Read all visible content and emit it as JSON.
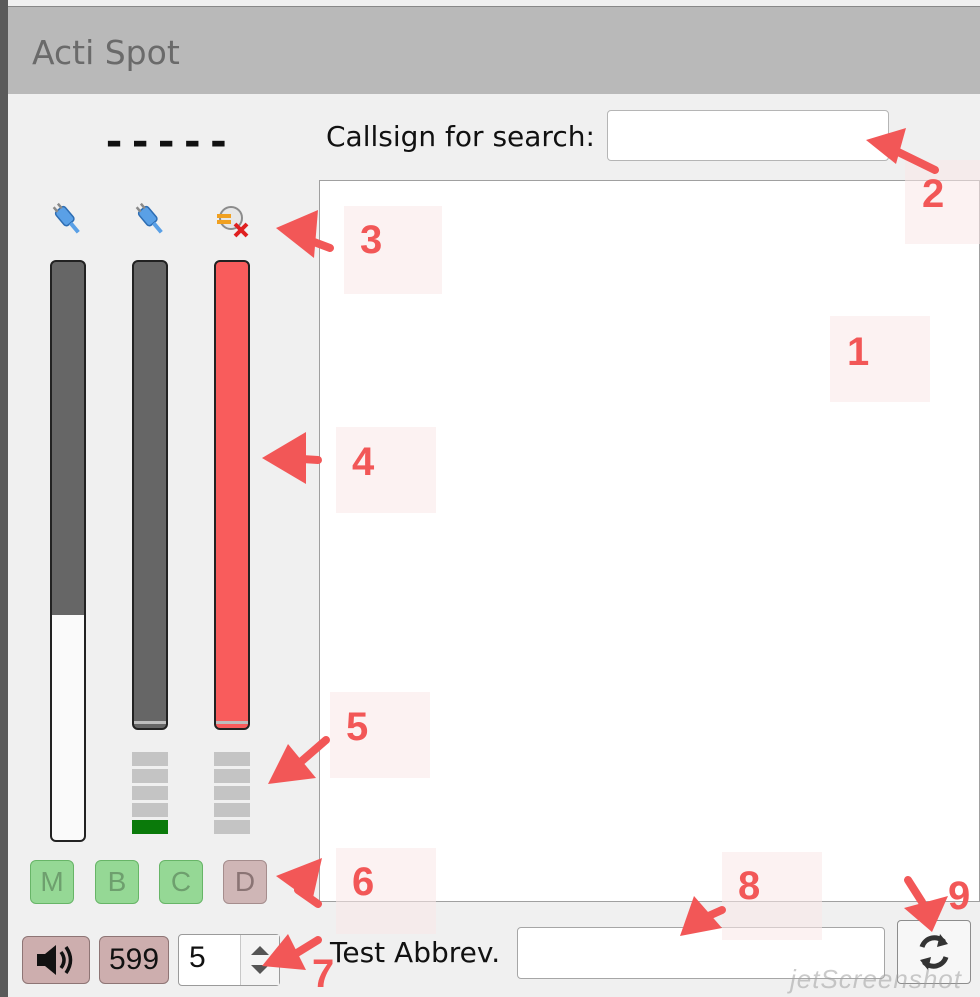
{
  "window": {
    "title": "Acti Spot"
  },
  "status": {
    "dashes": "-----"
  },
  "search": {
    "label": "Callsign for search:",
    "value": ""
  },
  "meters": [
    {
      "name": "meter-1",
      "level_fraction": 0.39,
      "color": "#666666"
    },
    {
      "name": "meter-2",
      "level_fraction": 0.0,
      "color": "#666666"
    },
    {
      "name": "meter-3",
      "level_fraction": 0.0,
      "color": "#f95c5c"
    }
  ],
  "leds": {
    "stack_2_lit_count": 1,
    "lit_color": "#0a7a0a",
    "unlit_color": "#c4c4c4"
  },
  "mode_buttons": [
    {
      "label": "M",
      "state": "enabled"
    },
    {
      "label": "B",
      "state": "enabled"
    },
    {
      "label": "C",
      "state": "enabled"
    },
    {
      "label": "D",
      "state": "disabled"
    }
  ],
  "bottom": {
    "speaker_icon": "speaker-icon",
    "count_label": "599",
    "spin_value": "5",
    "abbrev_label": "Test Abbrev.",
    "abbrev_value": "",
    "refresh_icon": "refresh-icon"
  },
  "callouts": [
    "1",
    "2",
    "3",
    "4",
    "5",
    "6",
    "7",
    "8",
    "9"
  ],
  "watermark": "jetScreenshot",
  "colors": {
    "titlebar": "#b9b9b9",
    "callout_red": "#f25757",
    "mode_green": "#95d895",
    "mode_disabled": "#cfb6b6"
  }
}
